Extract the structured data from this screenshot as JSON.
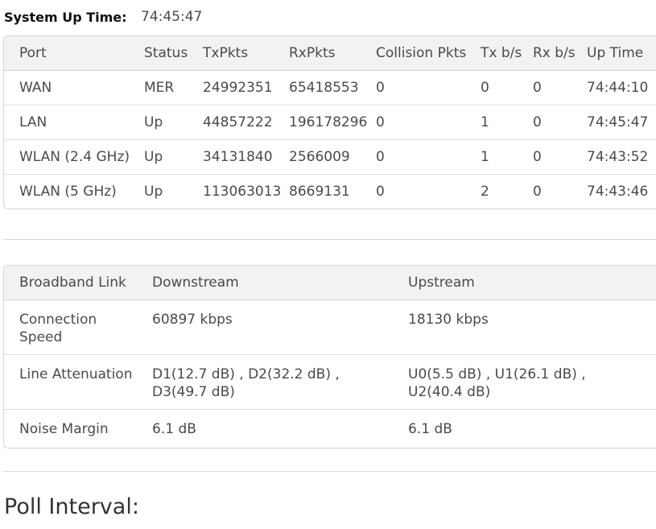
{
  "system": {
    "uptime_label": "System Up Time:",
    "uptime_value": "74:45:47"
  },
  "ports_table": {
    "headers": [
      "Port",
      "Status",
      "TxPkts",
      "RxPkts",
      "Collision Pkts",
      "Tx b/s",
      "Rx b/s",
      "Up Time"
    ],
    "rows": [
      [
        "WAN",
        "MER",
        "24992351",
        "65418553",
        "0",
        "0",
        "0",
        "74:44:10"
      ],
      [
        "LAN",
        "Up",
        "44857222",
        "196178296",
        "0",
        "1",
        "0",
        "74:45:47"
      ],
      [
        "WLAN (2.4 GHz)",
        "Up",
        "34131840",
        "2566009",
        "0",
        "1",
        "0",
        "74:43:52"
      ],
      [
        "WLAN (5 GHz)",
        "Up",
        "113063013",
        "8669131",
        "0",
        "2",
        "0",
        "74:43:46"
      ]
    ]
  },
  "broadband_table": {
    "headers": [
      "Broadband Link",
      "Downstream",
      "Upstream"
    ],
    "rows": [
      [
        "Connection Speed",
        "60897 kbps",
        "18130 kbps"
      ],
      [
        "Line Attenuation",
        "D1(12.7 dB) , D2(32.2 dB) , D3(49.7 dB)",
        "U0(5.5 dB) , U1(26.1 dB) , U2(40.4 dB)"
      ],
      [
        "Noise Margin",
        "6.1 dB",
        "6.1 dB"
      ]
    ]
  },
  "poll": {
    "label": "Poll Interval:"
  }
}
